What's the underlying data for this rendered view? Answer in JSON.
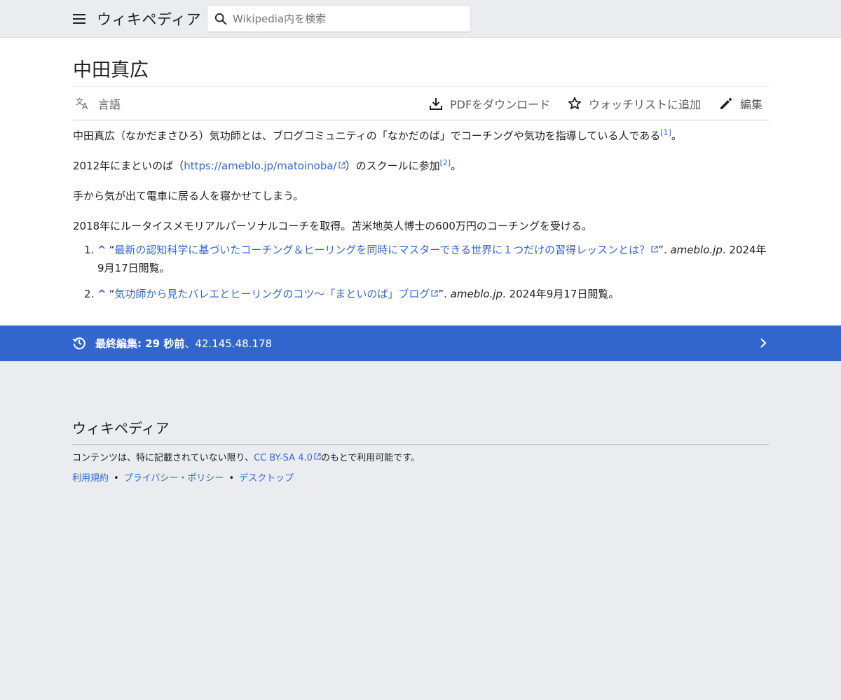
{
  "header": {
    "brand": "ウィキペディア",
    "search_placeholder": "Wikipedia内を検索"
  },
  "page": {
    "title": "中田真広"
  },
  "toolbar": {
    "language": "言語",
    "pdf": "PDFをダウンロード",
    "watchlist": "ウォッチリストに追加",
    "edit": "編集"
  },
  "body": {
    "p1_text": "中田真広（なかだまさひろ）気功師とは、ブログコミュニティの「なかだのば」でコーチングや気功を指導している人である",
    "p1_ref": "[1]",
    "p1_end": "。",
    "p2_start": "2012年にまといのば（",
    "p2_link": "https://ameblo.jp/matoinoba/",
    "p2_mid": "）のスクールに参加",
    "p2_ref": "[2]",
    "p2_end": "。",
    "p3": "手から気が出て電車に居る人を寝かせてしまう。",
    "p4": "2018年にルータイスメモリアルパーソナルコーチを取得。苫米地英人博士の600万円のコーチングを受ける。"
  },
  "references": [
    {
      "number": "1.",
      "caret": "^",
      "open_quote": "“",
      "title": "最新の認知科学に基づいたコーチング＆ヒーリングを同時にマスターできる世界に１つだけの習得レッスンとは？",
      "close_quote": "”. ",
      "site": "ameblo.jp",
      "accessed": ". 2024年9月17日閲覧。"
    },
    {
      "number": "2.",
      "caret": "^",
      "open_quote": "“",
      "title": "気功師から見たバレエとヒーリングのコツ〜「まといのば」ブログ",
      "close_quote": "”. ",
      "site": "ameblo.jp",
      "accessed": ". 2024年9月17日閲覧。"
    }
  ],
  "last_edit": {
    "label": "最終編集: 29 秒前",
    "separator": "、",
    "editor": "42.145.48.178"
  },
  "footer": {
    "brand": "ウィキペディア",
    "license_start": "コンテンツは、特に記載されていない限り、",
    "license_link": "CC BY-SA 4.0",
    "license_end": "のもとで利用可能です。",
    "links": [
      "利用規約",
      "プライバシー・ポリシー",
      "デスクトップ"
    ],
    "link_separator": "•"
  },
  "colors": {
    "accent": "#3366cc",
    "header_bg": "#eaecf0",
    "text": "#202122"
  }
}
